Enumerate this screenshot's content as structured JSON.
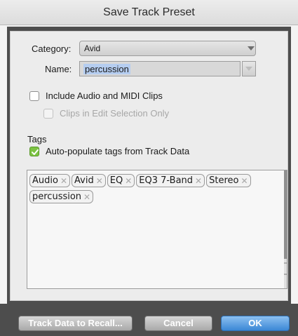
{
  "window": {
    "title": "Save Track Preset"
  },
  "category": {
    "label": "Category:",
    "value": "Avid"
  },
  "name": {
    "label": "Name:",
    "value": "percussion"
  },
  "include_clips": {
    "label": "Include Audio and MIDI Clips",
    "checked": false
  },
  "clips_edit_selection": {
    "label": "Clips in Edit Selection Only",
    "checked": false,
    "disabled": true
  },
  "tags": {
    "heading": "Tags",
    "autopopulate": {
      "label": "Auto-populate tags from Track Data",
      "checked": true
    },
    "items": [
      "Audio",
      "Avid",
      "EQ",
      "EQ3 7-Band",
      "Stereo",
      "percussion"
    ],
    "remove_glyph": "✕"
  },
  "buttons": {
    "track_data": "Track Data to Recall...",
    "cancel": "Cancel",
    "ok": "OK"
  },
  "colors": {
    "ok_accent": "#3b87d6",
    "check_green": "#7cc242",
    "selection": "#b5cdf0"
  }
}
